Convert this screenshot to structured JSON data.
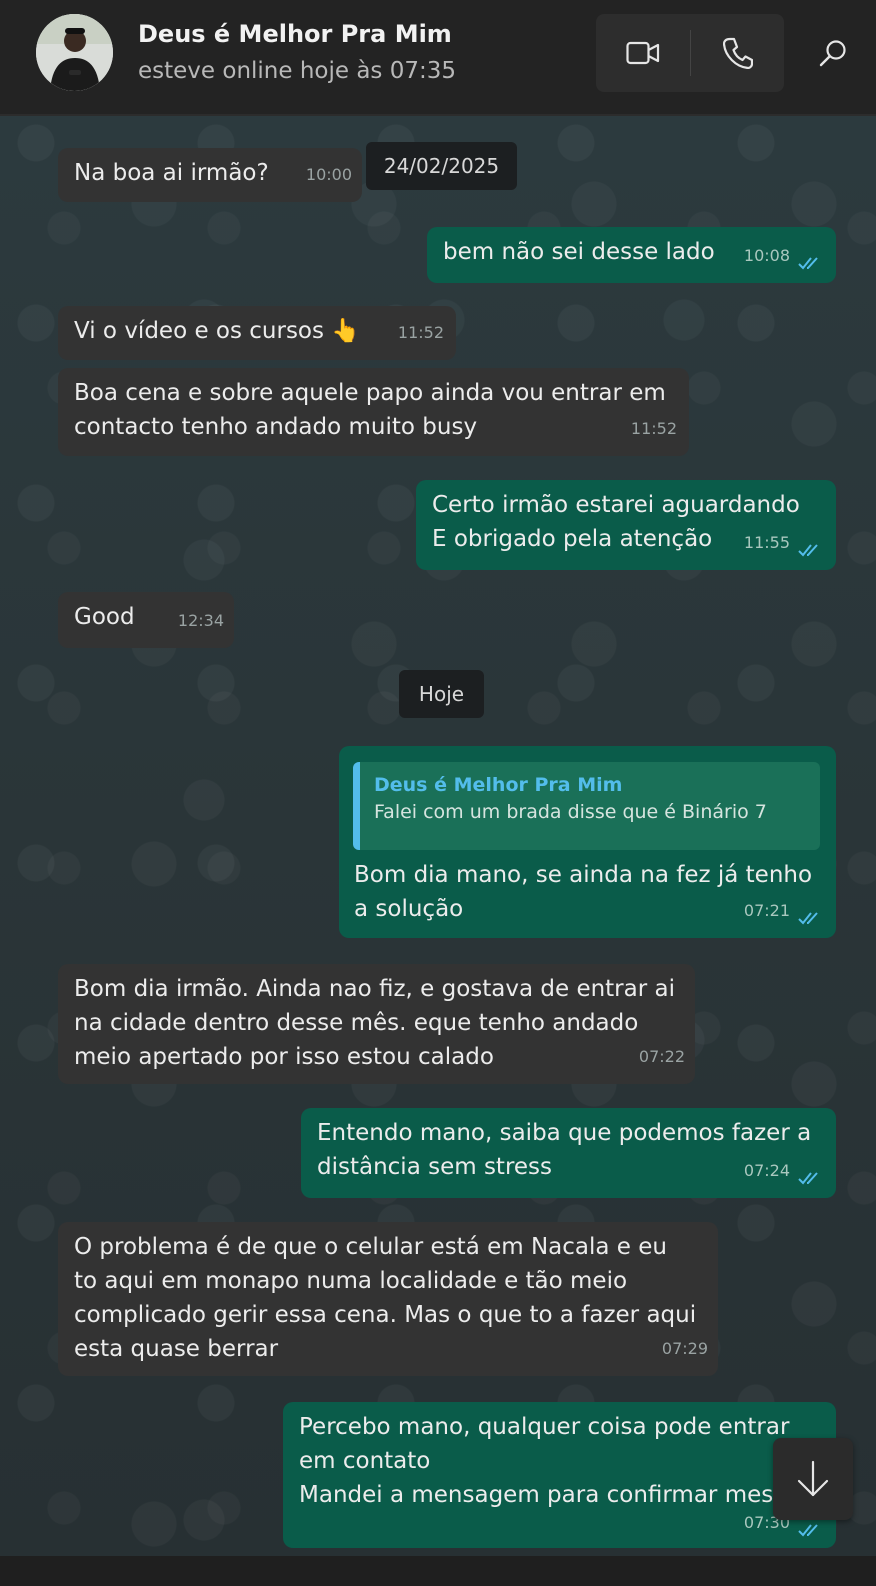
{
  "header": {
    "contact_name": "Deus é Melhor Pra Mim",
    "status": "esteve online hoje às 07:35",
    "icons": [
      "video-call-icon",
      "voice-call-icon",
      "search-icon"
    ]
  },
  "date_chips": {
    "first": "24/02/2025",
    "today": "Hoje"
  },
  "messages": [
    {
      "direction": "in",
      "text": "Na boa ai irmão?",
      "time": "10:00"
    },
    {
      "direction": "out",
      "text": "bem não sei desse lado",
      "time": "10:08",
      "read": true
    },
    {
      "direction": "in",
      "text": "Vi o vídeo e os cursos 👆",
      "time": "11:52"
    },
    {
      "direction": "in",
      "text": "Boa cena e sobre aquele papo ainda vou entrar em\ncontacto tenho andado muito busy",
      "time": "11:52"
    },
    {
      "direction": "out",
      "text": "Certo irmão estarei aguardando\nE obrigado pela atenção",
      "time": "11:55",
      "read": true
    },
    {
      "direction": "in",
      "text": "Good",
      "time": "12:34"
    },
    {
      "direction": "out",
      "quote_author": "Deus é Melhor Pra Mim",
      "quote_text": "Falei com um brada disse que é Binário 7",
      "text": "Bom dia mano, se ainda na fez já tenho\na solução",
      "time": "07:21",
      "read": true
    },
    {
      "direction": "in",
      "text": "Bom dia irmão. Ainda nao fiz, e gostava de entrar ai\nna cidade dentro desse mês. eque tenho andado\nmeio apertado por isso estou calado",
      "time": "07:22"
    },
    {
      "direction": "out",
      "text": "Entendo mano, saiba que podemos fazer a\ndistância sem stress",
      "time": "07:24",
      "read": true
    },
    {
      "direction": "in",
      "text": "O problema é de que o celular está em Nacala e eu\nto aqui em monapo numa localidade e  tão meio\ncomplicado gerir essa cena. Mas o que to a fazer aqui\nesta quase berrar",
      "time": "07:29"
    },
    {
      "direction": "out",
      "text": "Percebo mano, qualquer coisa pode entrar\nem contato\nMandei a mensagem para confirmar mesm",
      "time": "07:30",
      "read": true
    }
  ],
  "colors": {
    "incoming_bubble": "#333333",
    "outgoing_bubble": "#0a5c4a",
    "read_ticks": "#53bdeb",
    "header_bg": "#232323"
  }
}
